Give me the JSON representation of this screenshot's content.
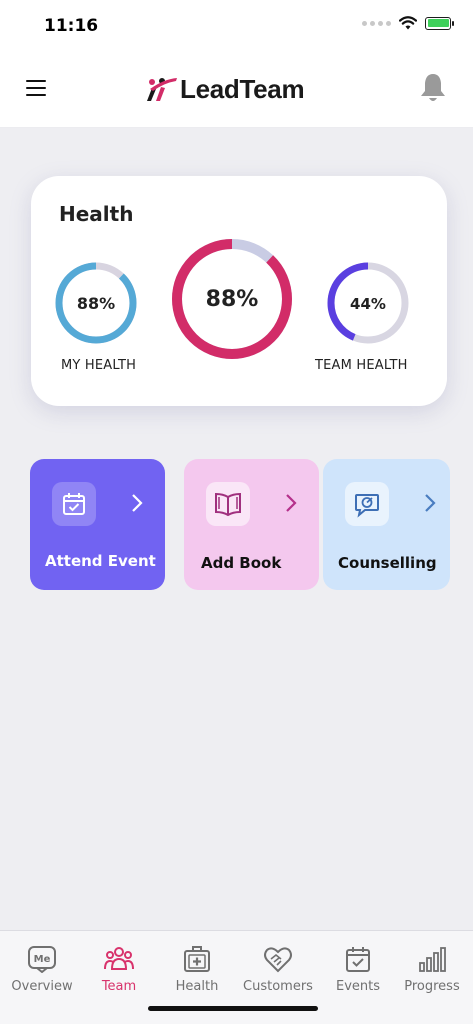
{
  "status_bar": {
    "time": "11:16"
  },
  "header": {
    "logo_text": "LeadTeam",
    "menu_icon": "hamburger-menu-icon",
    "bell_icon": "bell-icon"
  },
  "health_card": {
    "title": "Health",
    "my_health": {
      "value_text": "88%",
      "percent": 88,
      "label": "MY HEALTH",
      "color": "#55a9d6",
      "track": "#d8d4e0"
    },
    "overall": {
      "value_text": "88%",
      "percent": 88,
      "color": "#d22c68",
      "track": "#c9cce4"
    },
    "team_health": {
      "value_text": "44%",
      "percent": 44,
      "label": "TEAM HEALTH",
      "color": "#5a3fe0",
      "track": "#d8d6e2"
    }
  },
  "tiles": [
    {
      "label": "Attend Event",
      "icon": "calendar-check-icon",
      "bg": "#7163f2",
      "text_color": "#ffffff"
    },
    {
      "label": "Add Book",
      "icon": "open-book-icon",
      "bg": "#f4c8ee",
      "text_color": "#111111"
    },
    {
      "label": "Counselling",
      "icon": "chat-target-icon",
      "bg": "#cfe4fb",
      "text_color": "#111111"
    }
  ],
  "bottom_nav": [
    {
      "label": "Overview",
      "icon": "me-badge-icon",
      "badge_text": "Me",
      "active": false
    },
    {
      "label": "Team",
      "icon": "team-icon",
      "active": true
    },
    {
      "label": "Health",
      "icon": "medical-kit-icon",
      "active": false
    },
    {
      "label": "Customers",
      "icon": "handshake-heart-icon",
      "active": false
    },
    {
      "label": "Events",
      "icon": "calendar-check-icon",
      "active": false
    },
    {
      "label": "Progress",
      "icon": "bar-chart-icon",
      "active": false
    }
  ],
  "colors": {
    "accent": "#d8336c",
    "background": "#eeeef2"
  }
}
